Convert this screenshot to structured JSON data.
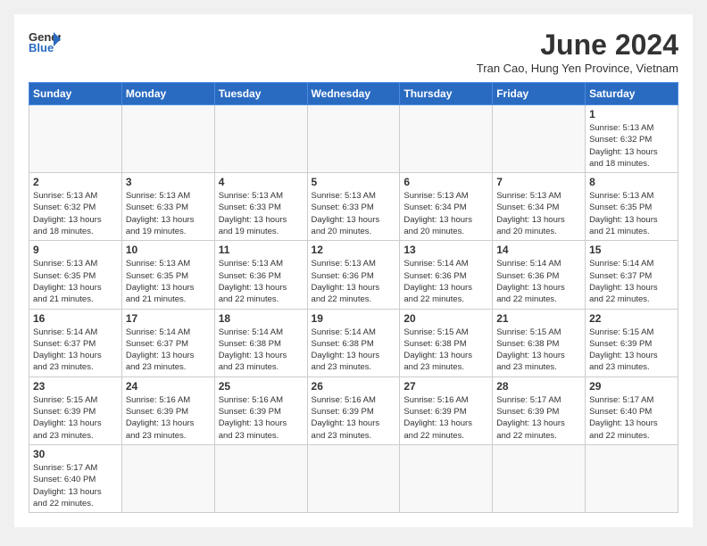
{
  "logo": {
    "text_general": "General",
    "text_blue": "Blue"
  },
  "header": {
    "month_year": "June 2024",
    "location": "Tran Cao, Hung Yen Province, Vietnam"
  },
  "weekdays": [
    "Sunday",
    "Monday",
    "Tuesday",
    "Wednesday",
    "Thursday",
    "Friday",
    "Saturday"
  ],
  "days": [
    {
      "date": "",
      "info": ""
    },
    {
      "date": "",
      "info": ""
    },
    {
      "date": "",
      "info": ""
    },
    {
      "date": "",
      "info": ""
    },
    {
      "date": "",
      "info": ""
    },
    {
      "date": "",
      "info": ""
    },
    {
      "date": "1",
      "info": "Sunrise: 5:13 AM\nSunset: 6:32 PM\nDaylight: 13 hours and 18 minutes."
    },
    {
      "date": "2",
      "info": "Sunrise: 5:13 AM\nSunset: 6:32 PM\nDaylight: 13 hours and 18 minutes."
    },
    {
      "date": "3",
      "info": "Sunrise: 5:13 AM\nSunset: 6:33 PM\nDaylight: 13 hours and 19 minutes."
    },
    {
      "date": "4",
      "info": "Sunrise: 5:13 AM\nSunset: 6:33 PM\nDaylight: 13 hours and 19 minutes."
    },
    {
      "date": "5",
      "info": "Sunrise: 5:13 AM\nSunset: 6:33 PM\nDaylight: 13 hours and 20 minutes."
    },
    {
      "date": "6",
      "info": "Sunrise: 5:13 AM\nSunset: 6:34 PM\nDaylight: 13 hours and 20 minutes."
    },
    {
      "date": "7",
      "info": "Sunrise: 5:13 AM\nSunset: 6:34 PM\nDaylight: 13 hours and 20 minutes."
    },
    {
      "date": "8",
      "info": "Sunrise: 5:13 AM\nSunset: 6:35 PM\nDaylight: 13 hours and 21 minutes."
    },
    {
      "date": "9",
      "info": "Sunrise: 5:13 AM\nSunset: 6:35 PM\nDaylight: 13 hours and 21 minutes."
    },
    {
      "date": "10",
      "info": "Sunrise: 5:13 AM\nSunset: 6:35 PM\nDaylight: 13 hours and 21 minutes."
    },
    {
      "date": "11",
      "info": "Sunrise: 5:13 AM\nSunset: 6:36 PM\nDaylight: 13 hours and 22 minutes."
    },
    {
      "date": "12",
      "info": "Sunrise: 5:13 AM\nSunset: 6:36 PM\nDaylight: 13 hours and 22 minutes."
    },
    {
      "date": "13",
      "info": "Sunrise: 5:14 AM\nSunset: 6:36 PM\nDaylight: 13 hours and 22 minutes."
    },
    {
      "date": "14",
      "info": "Sunrise: 5:14 AM\nSunset: 6:36 PM\nDaylight: 13 hours and 22 minutes."
    },
    {
      "date": "15",
      "info": "Sunrise: 5:14 AM\nSunset: 6:37 PM\nDaylight: 13 hours and 22 minutes."
    },
    {
      "date": "16",
      "info": "Sunrise: 5:14 AM\nSunset: 6:37 PM\nDaylight: 13 hours and 23 minutes."
    },
    {
      "date": "17",
      "info": "Sunrise: 5:14 AM\nSunset: 6:37 PM\nDaylight: 13 hours and 23 minutes."
    },
    {
      "date": "18",
      "info": "Sunrise: 5:14 AM\nSunset: 6:38 PM\nDaylight: 13 hours and 23 minutes."
    },
    {
      "date": "19",
      "info": "Sunrise: 5:14 AM\nSunset: 6:38 PM\nDaylight: 13 hours and 23 minutes."
    },
    {
      "date": "20",
      "info": "Sunrise: 5:15 AM\nSunset: 6:38 PM\nDaylight: 13 hours and 23 minutes."
    },
    {
      "date": "21",
      "info": "Sunrise: 5:15 AM\nSunset: 6:38 PM\nDaylight: 13 hours and 23 minutes."
    },
    {
      "date": "22",
      "info": "Sunrise: 5:15 AM\nSunset: 6:39 PM\nDaylight: 13 hours and 23 minutes."
    },
    {
      "date": "23",
      "info": "Sunrise: 5:15 AM\nSunset: 6:39 PM\nDaylight: 13 hours and 23 minutes."
    },
    {
      "date": "24",
      "info": "Sunrise: 5:16 AM\nSunset: 6:39 PM\nDaylight: 13 hours and 23 minutes."
    },
    {
      "date": "25",
      "info": "Sunrise: 5:16 AM\nSunset: 6:39 PM\nDaylight: 13 hours and 23 minutes."
    },
    {
      "date": "26",
      "info": "Sunrise: 5:16 AM\nSunset: 6:39 PM\nDaylight: 13 hours and 23 minutes."
    },
    {
      "date": "27",
      "info": "Sunrise: 5:16 AM\nSunset: 6:39 PM\nDaylight: 13 hours and 22 minutes."
    },
    {
      "date": "28",
      "info": "Sunrise: 5:17 AM\nSunset: 6:39 PM\nDaylight: 13 hours and 22 minutes."
    },
    {
      "date": "29",
      "info": "Sunrise: 5:17 AM\nSunset: 6:40 PM\nDaylight: 13 hours and 22 minutes."
    },
    {
      "date": "30",
      "info": "Sunrise: 5:17 AM\nSunset: 6:40 PM\nDaylight: 13 hours and 22 minutes."
    },
    {
      "date": "",
      "info": ""
    },
    {
      "date": "",
      "info": ""
    },
    {
      "date": "",
      "info": ""
    },
    {
      "date": "",
      "info": ""
    },
    {
      "date": "",
      "info": ""
    },
    {
      "date": "",
      "info": ""
    }
  ]
}
